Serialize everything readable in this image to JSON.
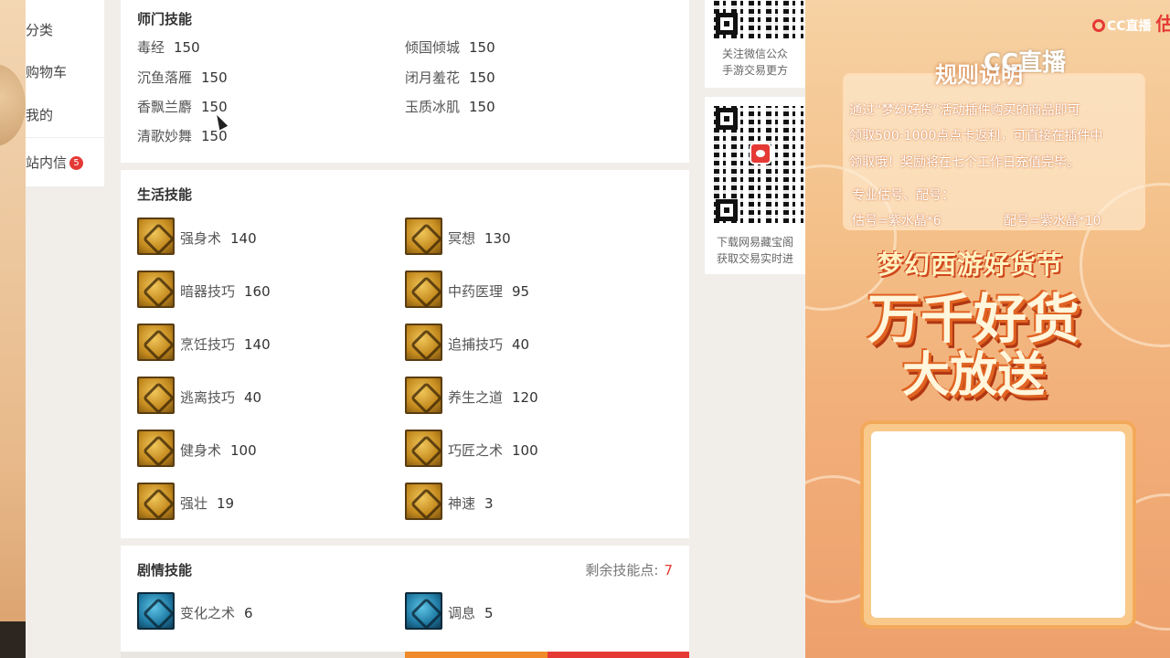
{
  "left_nav": {
    "items": [
      "分类",
      "购物车",
      "我的",
      "站内信"
    ],
    "inbox_badge": "5"
  },
  "shimen": {
    "title": "师门技能",
    "skills": [
      {
        "name": "毒经",
        "level": "150"
      },
      {
        "name": "倾国倾城",
        "level": "150"
      },
      {
        "name": "沉鱼落雁",
        "level": "150"
      },
      {
        "name": "闭月羞花",
        "level": "150"
      },
      {
        "name": "香飘兰麝",
        "level": "150"
      },
      {
        "name": "玉质冰肌",
        "level": "150"
      },
      {
        "name": "清歌妙舞",
        "level": "150"
      }
    ]
  },
  "life": {
    "title": "生活技能",
    "skills": [
      {
        "name": "强身术",
        "level": "140",
        "icon": "strength-icon"
      },
      {
        "name": "冥想",
        "level": "130",
        "icon": "meditate-icon"
      },
      {
        "name": "暗器技巧",
        "level": "160",
        "icon": "dart-icon"
      },
      {
        "name": "中药医理",
        "level": "95",
        "icon": "herb-icon"
      },
      {
        "name": "烹饪技巧",
        "level": "140",
        "icon": "cooking-icon"
      },
      {
        "name": "追捕技巧",
        "level": "40",
        "icon": "chase-icon"
      },
      {
        "name": "逃离技巧",
        "level": "40",
        "icon": "escape-icon"
      },
      {
        "name": "养生之道",
        "level": "120",
        "icon": "health-icon"
      },
      {
        "name": "健身术",
        "level": "100",
        "icon": "fitness-icon"
      },
      {
        "name": "巧匠之术",
        "level": "100",
        "icon": "craft-icon"
      },
      {
        "name": "强壮",
        "level": "19",
        "icon": "muscle-icon"
      },
      {
        "name": "神速",
        "level": "3",
        "icon": "speed-icon"
      }
    ]
  },
  "story": {
    "title": "剧情技能",
    "remaining_label": "剩余技能点:",
    "remaining_value": "7",
    "skills": [
      {
        "name": "变化之术",
        "level": "6",
        "icon": "transform-icon"
      },
      {
        "name": "调息",
        "level": "5",
        "icon": "breath-icon"
      }
    ]
  },
  "qr": {
    "wechat_line1": "关注微信公众",
    "wechat_line2": "手游交易更方",
    "app_line1": "下载网易藏宝阁",
    "app_line2": "获取交易实时进"
  },
  "ad": {
    "cc_logo": "CC直播",
    "cc_red": "估价",
    "cc_big": "CC直播",
    "rule_title": "规则说明",
    "rule_lines": [
      "通过“梦幻好货”活动插件购买的商品即可",
      "领取500-1000点点卡返利，可直接在插件中",
      "领取哦！奖励将在七个工作日充值完毕。"
    ],
    "service_title": "专业估号、配号：",
    "service_estimate": "估号=紫水晶*6",
    "service_match": "配号=紫水晶*10",
    "fest_title": "梦幻西游好货节",
    "big_line1": "万千好货",
    "big_line2": "大放送"
  },
  "colors": {
    "accent_red": "#e53935",
    "icon_gold": "#c48a1e",
    "icon_blue": "#1f7aa3",
    "bar_orange": "#f08a2a"
  }
}
